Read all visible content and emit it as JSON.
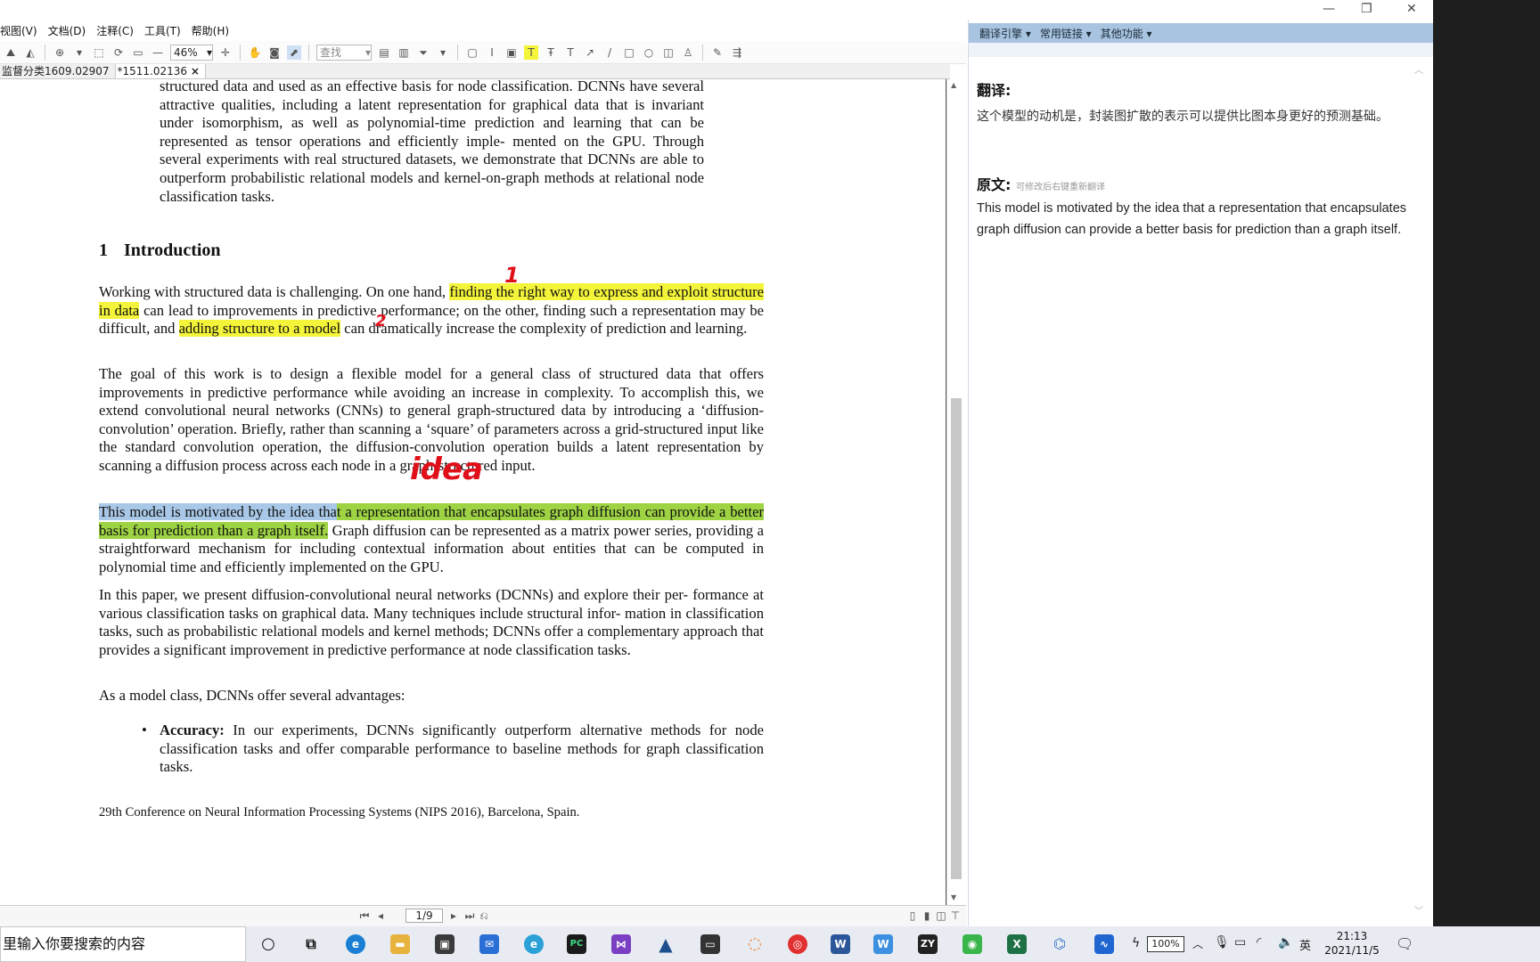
{
  "menu": [
    "视图(V)",
    "文档(D)",
    "注释(C)",
    "工具(T)",
    "帮助(H)"
  ],
  "toolbar": {
    "zoom": "46%",
    "find_placeholder": "查找"
  },
  "tabs": [
    {
      "label": "监督分类1609.02907",
      "active": false
    },
    {
      "label": "*1511.02136",
      "active": true,
      "close": "×"
    }
  ],
  "document": {
    "abstract_tail": "structured data and used as an effective basis for node classification. DCNNs have several attractive qualities, including a latent representation for graphical data that is invariant under isomorphism, as well as polynomial-time prediction and learning that can be represented as tensor operations and efficiently imple- mented on the GPU. Through several experiments with real structured datasets, we demonstrate that DCNNs are able to outperform probabilistic relational models and kernel-on-graph methods at relational node classification tasks.",
    "section_number": "1",
    "section_title": "Introduction",
    "p1_a": "Working with structured data is challenging. On one hand, ",
    "p1_hl1": "finding the right way to express and exploit structure in data",
    "p1_b": " can lead to improvements in predictive performance; on the other, finding such a representation may be difficult, and ",
    "p1_hl2": "adding structure to a model",
    "p1_c": " can dramatically increase the complexity of prediction and learning.",
    "p2": "The goal of this work is to design a flexible model for a general class of structured data that offers improvements in predictive performance while avoiding an increase in complexity. To accomplish this, we extend convolutional neural networks (CNNs) to general graph-structured data by introducing a ‘diffusion-convolution’ operation. Briefly, rather than scanning a ‘square’ of parameters across a grid-structured input like the standard convolution operation, the diffusion-convolution operation builds a latent representation by scanning a diffusion process across each node in a graph-structured input.",
    "p3_sel": "This model is motivated by the idea tha",
    "p3_hl": "t a representation that encapsulates graph diffusion can provide a better basis for prediction than a graph itself.",
    "p3_rest": " Graph diffusion can be represented as a matrix power series, providing a straightforward mechanism for including contextual information about entities that can be computed in polynomial time and efficiently implemented on the GPU.",
    "p4": "In this paper, we present diffusion-convolutional neural networks (DCNNs) and explore their per- formance at various classification tasks on graphical data. Many techniques include structural infor- mation in classification tasks, such as probabilistic relational models and kernel methods; DCNNs offer a complementary approach that provides a significant improvement in predictive performance at node classification tasks.",
    "p5": "As a model class, DCNNs offer several advantages:",
    "bullet_term": "Accuracy:",
    "bullet_text": " In our experiments, DCNNs significantly outperform alternative methods for node classification tasks and offer comparable performance to baseline methods for graph classification tasks.",
    "footnote": "29th Conference on Neural Information Processing Systems (NIPS 2016), Barcelona, Spain.",
    "annotations": {
      "mark1": "1",
      "mark2": "2",
      "idea": "idea"
    }
  },
  "page_nav": {
    "page": "1/9"
  },
  "panel": {
    "menu": [
      "翻译引擎 ▾",
      "常用链接 ▾",
      "其他功能 ▾"
    ],
    "translation_heading": "翻译:",
    "translation": "这个模型的动机是，封装图扩散的表示可以提供比图本身更好的预测基础。",
    "original_heading": "原文:",
    "original_note": "可修改后右键重新翻译",
    "original": "This model is motivated by the idea that a representation that encapsulates graph diffusion can provide a better basis for prediction than a graph itself."
  },
  "taskbar": {
    "search_placeholder": "里输入你要搜索的内容",
    "battery": "100%",
    "ime": "英",
    "time": "21:13",
    "date": "2021/11/5"
  }
}
